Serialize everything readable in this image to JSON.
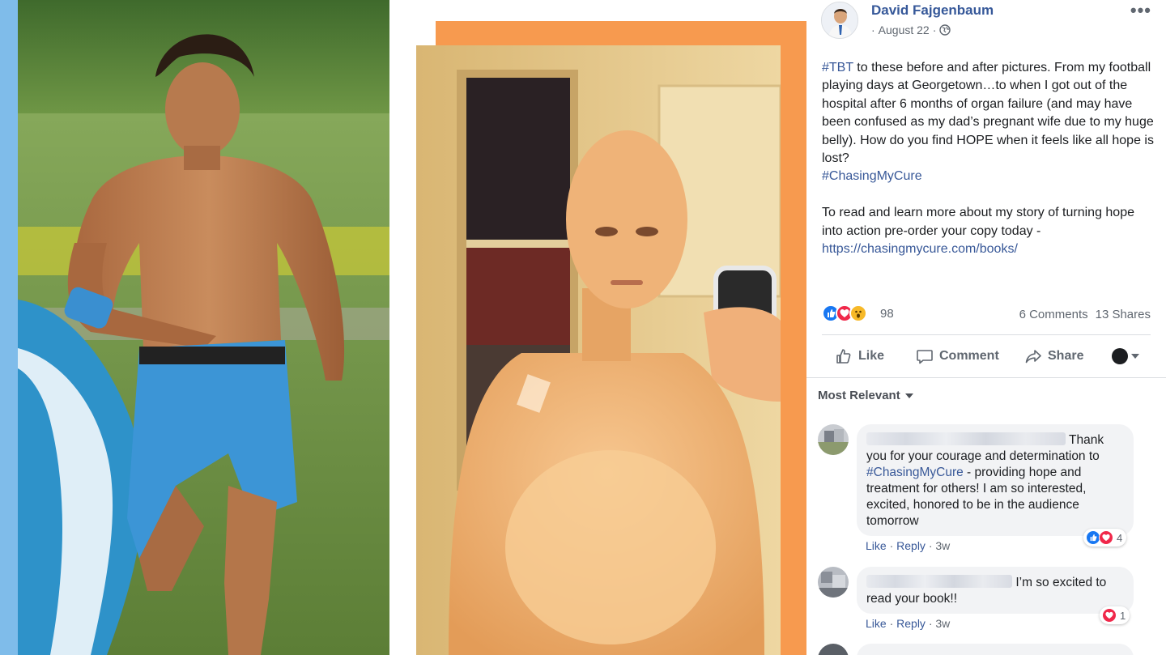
{
  "post": {
    "author": "David Fajgenbaum",
    "date": "August 22",
    "date_separator": "·",
    "privacy_icon": "globe-icon",
    "more_menu": "•••",
    "body": {
      "hashtag_tbt": "#TBT",
      "text_1": " to these before and after pictures. From my football playing days at Georgetown…to when I got out of the hospital after 6 months of organ failure (and may have been confused as my dad’s pregnant wife due to my huge belly). How do you find HOPE when it feels like all hope is lost?",
      "hashtag_cure": "#ChasingMyCure",
      "text_2": "To read and learn more about my story of turning hope into action pre-order your copy today -",
      "link": "https://chasingmycure.com/books/"
    },
    "reactions": {
      "icons": [
        "like-icon",
        "love-icon",
        "wow-icon"
      ],
      "count": "98"
    },
    "comments_count": "6 Comments",
    "shares_count": "13 Shares",
    "actions": {
      "like": "Like",
      "comment": "Comment",
      "share": "Share"
    },
    "sort_label": "Most Relevant"
  },
  "comments": [
    {
      "name_redacted": true,
      "text_first": "Thank",
      "text_2": "you for your courage and determination to",
      "hashtag": "#ChasingMyCure",
      "text_3": " - providing hope and",
      "text_4": "treatment for others! I am so interested,",
      "text_5": "excited, honored to be in the audience",
      "text_6": "tomorrow",
      "like": "Like",
      "reply": "Reply",
      "age": "3w",
      "reaction_count": "4"
    },
    {
      "name_redacted": true,
      "text_first": "I’m so excited to",
      "text_2": "read your book!!",
      "like": "Like",
      "reply": "Reply",
      "age": "3w",
      "reaction_count": "1"
    }
  ],
  "colors": {
    "link": "#385898",
    "author": "#365899",
    "frame_orange": "#f79a4f",
    "edge_blue": "#7fbcea"
  }
}
